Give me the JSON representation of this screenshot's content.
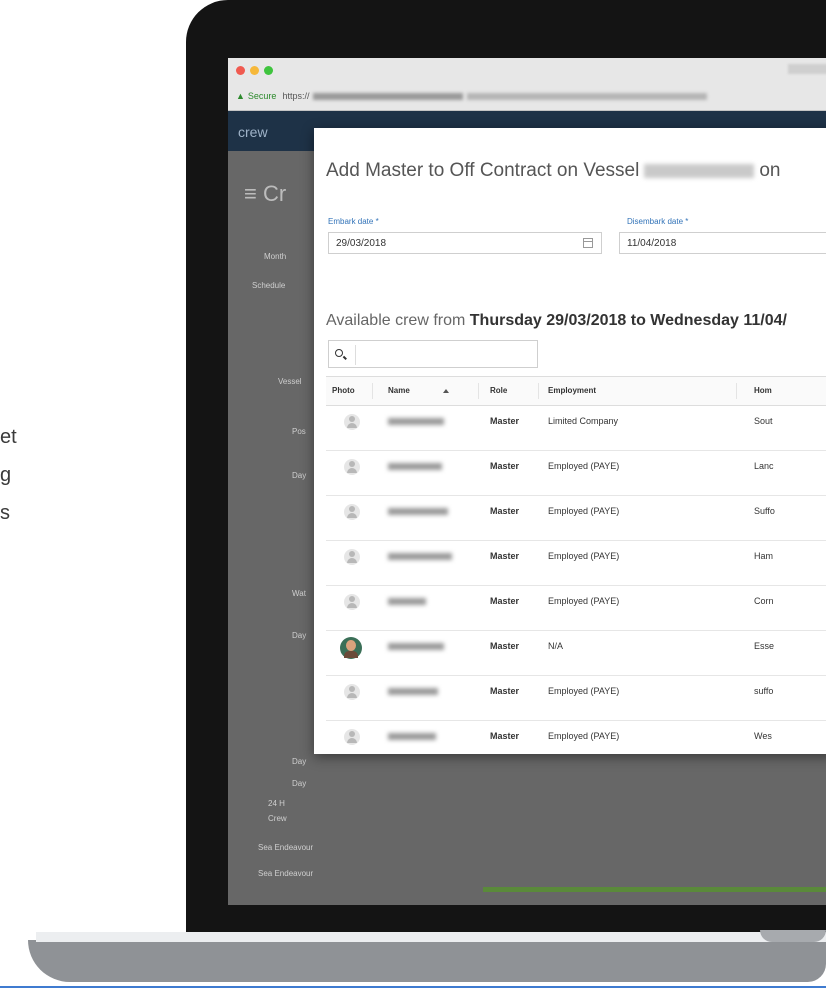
{
  "side_text": [
    "et",
    "g",
    "s"
  ],
  "browser": {
    "lock_icon": "lock-icon",
    "secure_label": "Secure",
    "url_prefix": "https://"
  },
  "app": {
    "brand": "crew",
    "page_title_partial": "Cr",
    "sidebar_fragments": [
      "Month",
      "Schedule",
      "Vessel",
      "Pos",
      "Day",
      "Wat",
      "Day",
      "Day",
      "Day",
      "24 H",
      "Crew",
      "Sea Endeavour",
      "Sea Endeavour"
    ]
  },
  "modal": {
    "title_prefix": "Add Master to Off Contract on Vessel",
    "title_suffix": "on",
    "embark_label": "Embark date *",
    "embark_value": "29/03/2018",
    "disembark_label": "Disembark date *",
    "disembark_value": "11/04/2018",
    "available_prefix": "Available crew from ",
    "available_range": "Thursday 29/03/2018 to Wednesday 11/04/",
    "search_placeholder": "",
    "columns": {
      "photo": "Photo",
      "name": "Name",
      "role": "Role",
      "employment": "Employment",
      "home": "Hom"
    },
    "rows": [
      {
        "role": "Master",
        "employment": "Limited Company",
        "home": "Sout",
        "has_photo": false
      },
      {
        "role": "Master",
        "employment": "Employed (PAYE)",
        "home": "Lanc",
        "has_photo": false
      },
      {
        "role": "Master",
        "employment": "Employed (PAYE)",
        "home": "Suffo",
        "has_photo": false
      },
      {
        "role": "Master",
        "employment": "Employed (PAYE)",
        "home": "Ham",
        "has_photo": false
      },
      {
        "role": "Master",
        "employment": "Employed (PAYE)",
        "home": "Corn",
        "has_photo": false
      },
      {
        "role": "Master",
        "employment": "N/A",
        "home": "Esse",
        "has_photo": true
      },
      {
        "role": "Master",
        "employment": "Employed (PAYE)",
        "home": "suffo",
        "has_photo": false
      },
      {
        "role": "Master",
        "employment": "Employed (PAYE)",
        "home": "Wes",
        "has_photo": false
      }
    ]
  },
  "colors": {
    "nav": "#1e3247",
    "label_blue": "#3273b8",
    "secure_green": "#2c8a2c",
    "progress_green": "#5a8a3a"
  }
}
